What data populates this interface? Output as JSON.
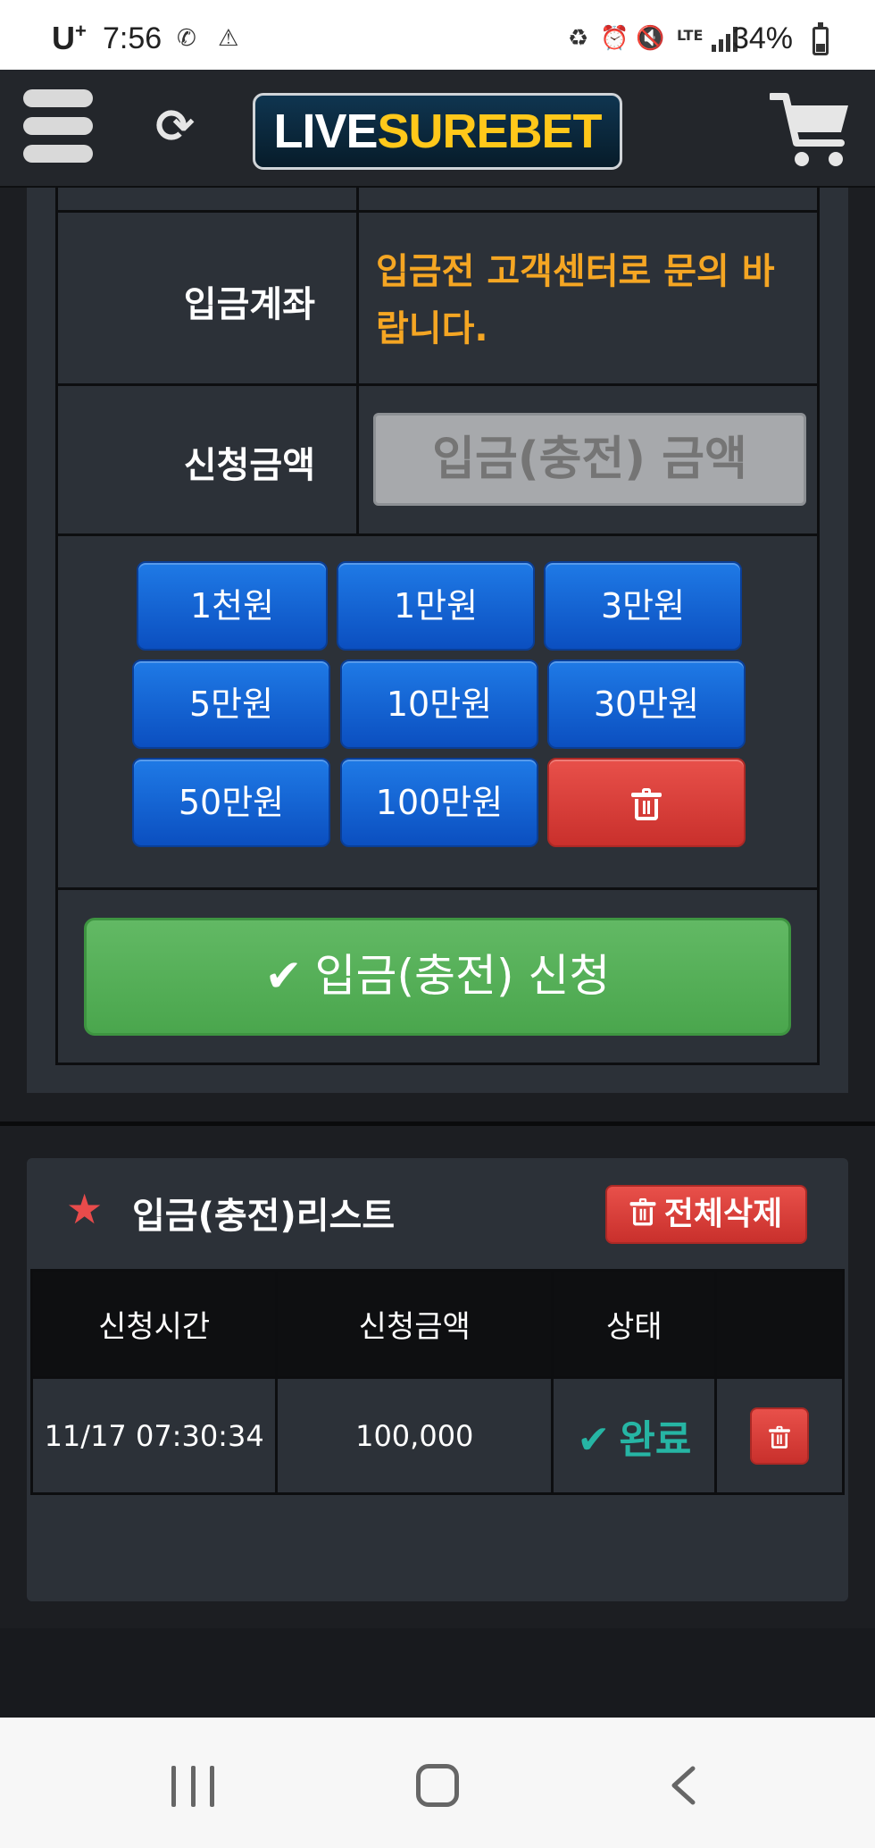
{
  "status_bar": {
    "carrier": "U",
    "carrier_sup": "+",
    "time": "7:56",
    "battery": "34%"
  },
  "header": {
    "logo_part1": "LIVE",
    "logo_part2": "SUREBET"
  },
  "form": {
    "account_label": "입금계좌",
    "account_notice": "입금전 고객센터로 문의 바랍니다.",
    "amount_label": "신청금액",
    "amount_placeholder": "입금(충전) 금액",
    "amount_value": "",
    "amount_buttons": [
      "1천원",
      "1만원",
      "3만원",
      "5만원",
      "10만원",
      "30만원",
      "50만원",
      "100만원"
    ],
    "submit_label": "입금(충전) 신청"
  },
  "list": {
    "title": "입금(충전)리스트",
    "delete_all_label": "전체삭제",
    "columns": [
      "신청시간",
      "신청금액",
      "상태",
      ""
    ],
    "rows": [
      {
        "time": "11/17 07:30:34",
        "amount": "100,000",
        "status": "완료"
      }
    ]
  },
  "colors": {
    "accent_notice": "#f5a623",
    "button_blue": "#1f7ae6",
    "button_red": "#d9534f",
    "submit_green": "#5cb85c",
    "status_done": "#26b5a4"
  }
}
